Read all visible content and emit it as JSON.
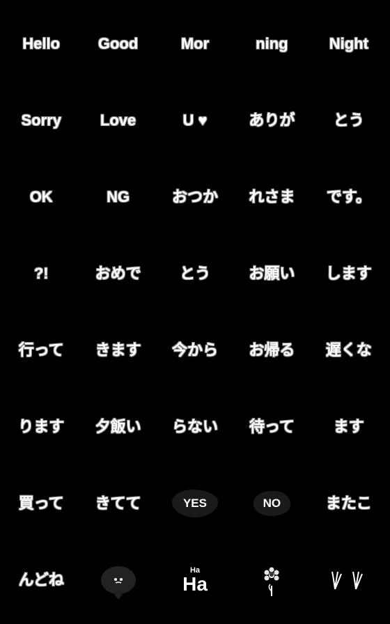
{
  "grid": {
    "rows": [
      [
        {
          "type": "text",
          "content": "Hello"
        },
        {
          "type": "text",
          "content": "Good"
        },
        {
          "type": "text",
          "content": "Mor"
        },
        {
          "type": "text",
          "content": "ning"
        },
        {
          "type": "text",
          "content": "Night"
        }
      ],
      [
        {
          "type": "text",
          "content": "Sorry"
        },
        {
          "type": "text",
          "content": "Love"
        },
        {
          "type": "text",
          "content": "U ♥"
        },
        {
          "type": "text",
          "content": "ありが"
        },
        {
          "type": "text",
          "content": "とう"
        }
      ],
      [
        {
          "type": "text",
          "content": "OK"
        },
        {
          "type": "text",
          "content": "NG"
        },
        {
          "type": "text",
          "content": "おつか"
        },
        {
          "type": "text",
          "content": "れさま"
        },
        {
          "type": "text",
          "content": "です。"
        }
      ],
      [
        {
          "type": "text",
          "content": "?!"
        },
        {
          "type": "text",
          "content": "おめで"
        },
        {
          "type": "text",
          "content": "とう"
        },
        {
          "type": "text",
          "content": "お願い"
        },
        {
          "type": "text",
          "content": "します"
        }
      ],
      [
        {
          "type": "text",
          "content": "行って"
        },
        {
          "type": "text",
          "content": "きます"
        },
        {
          "type": "text",
          "content": "今から"
        },
        {
          "type": "text",
          "content": "お帰る"
        },
        {
          "type": "text",
          "content": "遅くな"
        }
      ],
      [
        {
          "type": "text",
          "content": "ります"
        },
        {
          "type": "text",
          "content": "夕飯い"
        },
        {
          "type": "text",
          "content": "らない"
        },
        {
          "type": "text",
          "content": "待って"
        },
        {
          "type": "text",
          "content": "ます"
        }
      ],
      [
        {
          "type": "text",
          "content": "買って"
        },
        {
          "type": "text",
          "content": "きてて"
        },
        {
          "type": "blob",
          "content": "YES"
        },
        {
          "type": "blob-no",
          "content": "NO"
        },
        {
          "type": "text",
          "content": "またこ"
        }
      ],
      [
        {
          "type": "text",
          "content": "んどね"
        },
        {
          "type": "speech",
          "content": "😶"
        },
        {
          "type": "ha",
          "small": "Ha",
          "big": "Ha"
        },
        {
          "type": "flower"
        },
        {
          "type": "grass"
        }
      ]
    ]
  }
}
